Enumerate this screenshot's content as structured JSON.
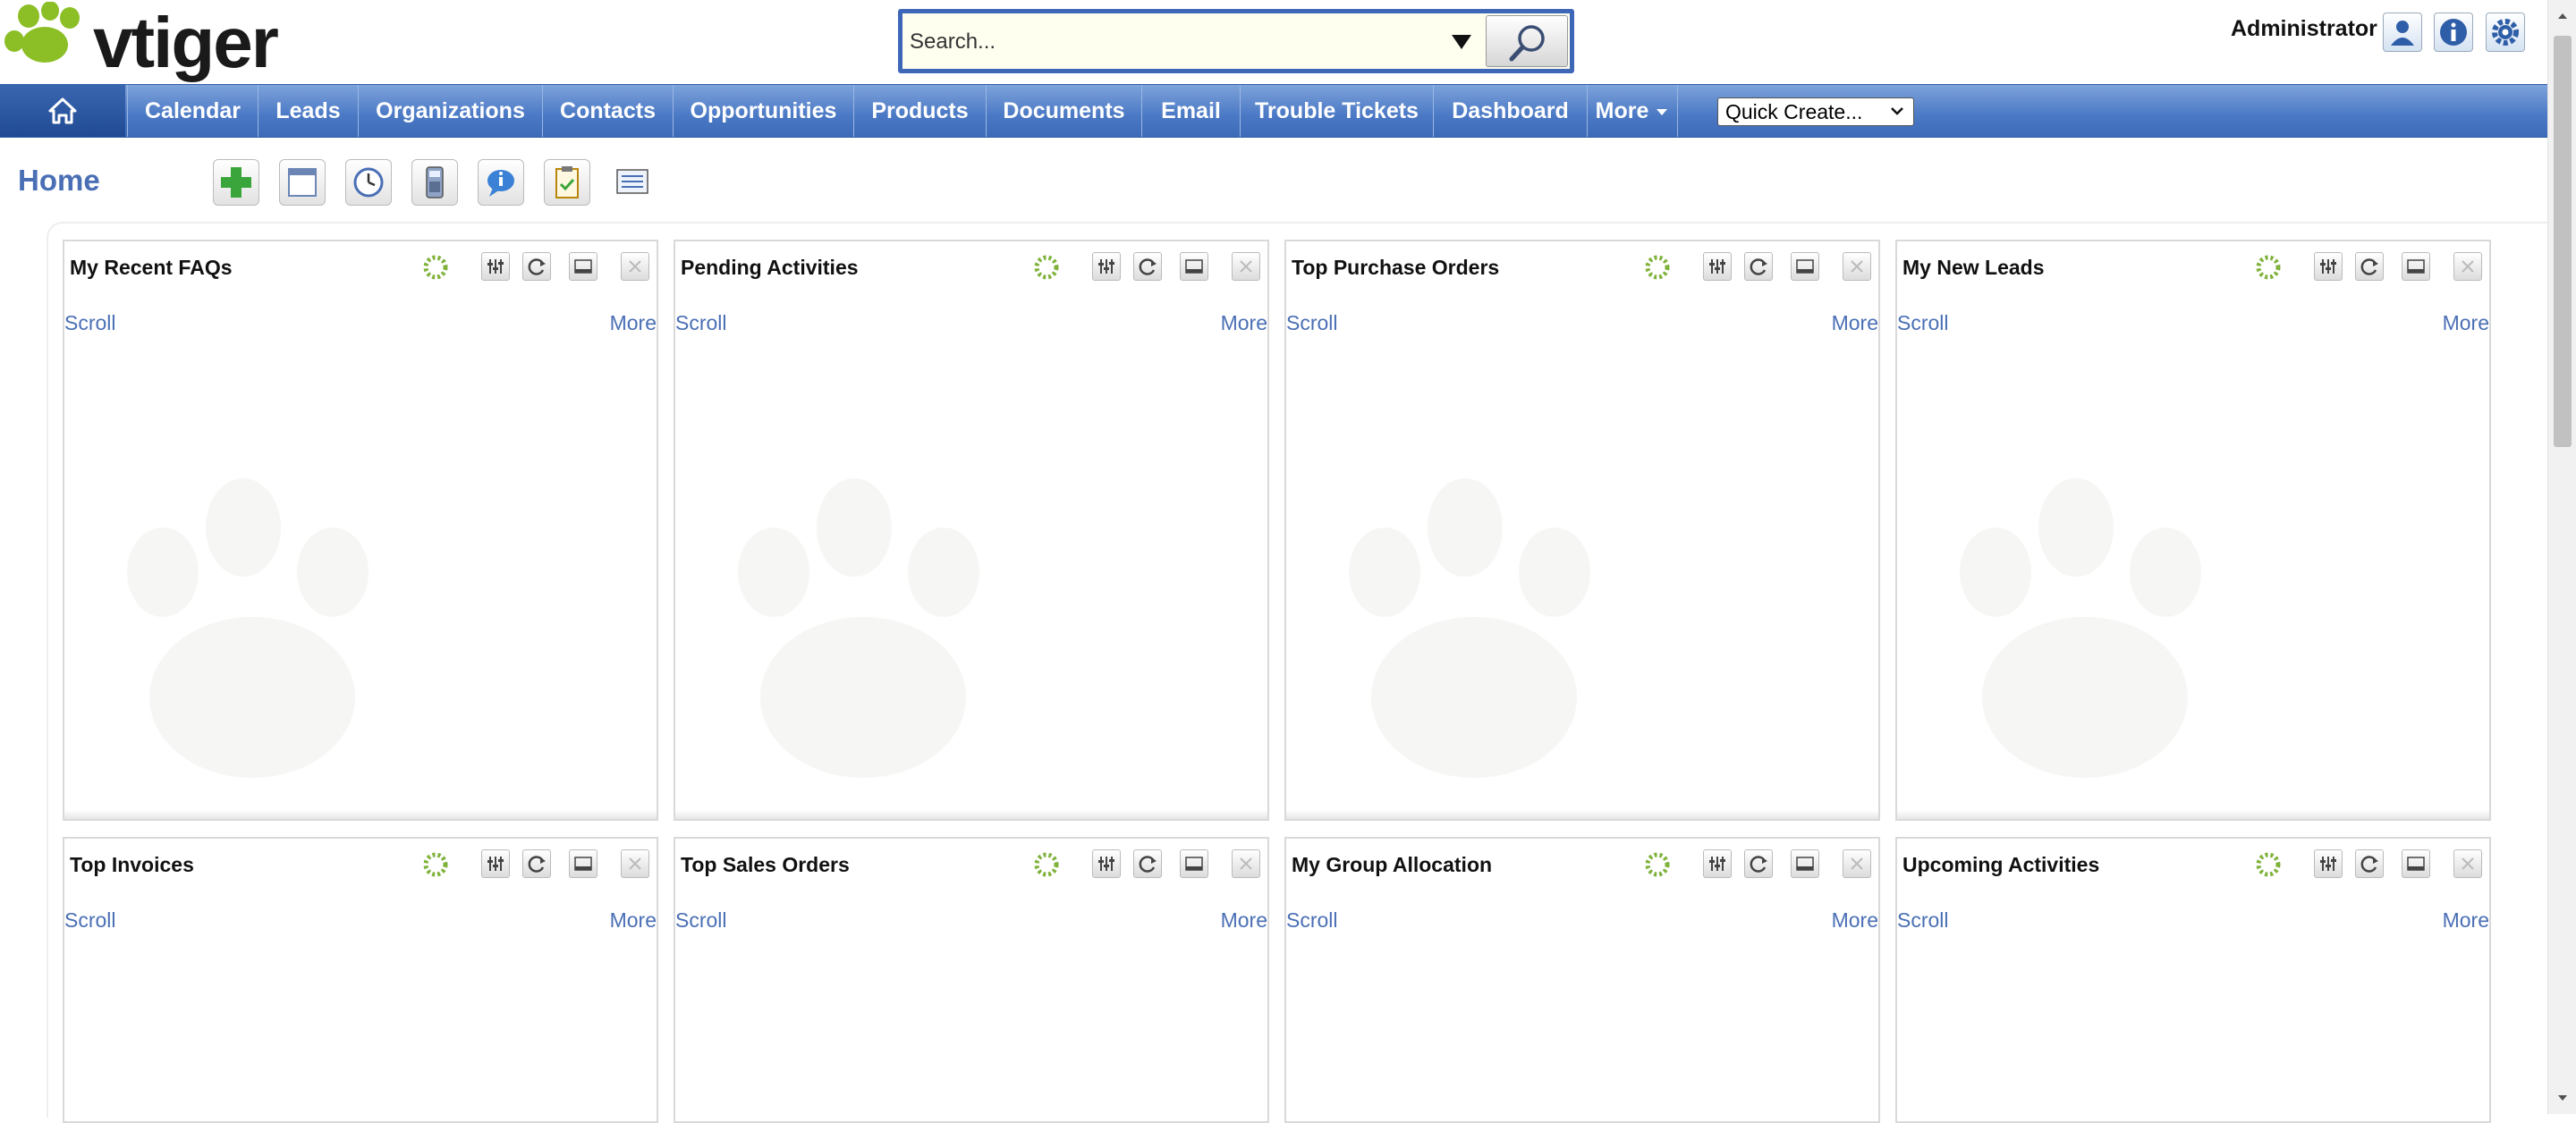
{
  "brand": {
    "logo_text": "vtiger"
  },
  "search": {
    "placeholder": "Search..."
  },
  "user": {
    "name": "Administrator"
  },
  "nav": {
    "items": [
      "Calendar",
      "Leads",
      "Organizations",
      "Contacts",
      "Opportunities",
      "Products",
      "Documents",
      "Email",
      "Trouble Tickets",
      "Dashboard",
      "More"
    ],
    "quick_create": "Quick Create..."
  },
  "home": {
    "title": "Home"
  },
  "widgets": [
    {
      "title": "My Recent FAQs",
      "scroll": "Scroll",
      "more": "More"
    },
    {
      "title": "Pending Activities",
      "scroll": "Scroll",
      "more": "More"
    },
    {
      "title": "Top Purchase Orders",
      "scroll": "Scroll",
      "more": "More"
    },
    {
      "title": "My New Leads",
      "scroll": "Scroll",
      "more": "More"
    },
    {
      "title": "Top Invoices",
      "scroll": "Scroll",
      "more": "More"
    },
    {
      "title": "Top Sales Orders",
      "scroll": "Scroll",
      "more": "More"
    },
    {
      "title": "My Group Allocation",
      "scroll": "Scroll",
      "more": "More"
    },
    {
      "title": "Upcoming Activities",
      "scroll": "Scroll",
      "more": "More"
    }
  ],
  "colors": {
    "nav_blue": "#4a78c4",
    "link_blue": "#4a6fb5",
    "logo_green": "#8cbf26"
  },
  "icons": {
    "header": [
      "user-icon",
      "info-icon",
      "settings-icon"
    ],
    "toolbar": [
      "add-widget-icon",
      "layout-icon",
      "clock-icon",
      "calculator-icon",
      "chat-icon",
      "clipboard-icon",
      "notebook-icon"
    ],
    "widget": [
      "loading-spinner-icon",
      "filter-icon",
      "refresh-icon",
      "minimize-icon",
      "close-icon"
    ]
  }
}
